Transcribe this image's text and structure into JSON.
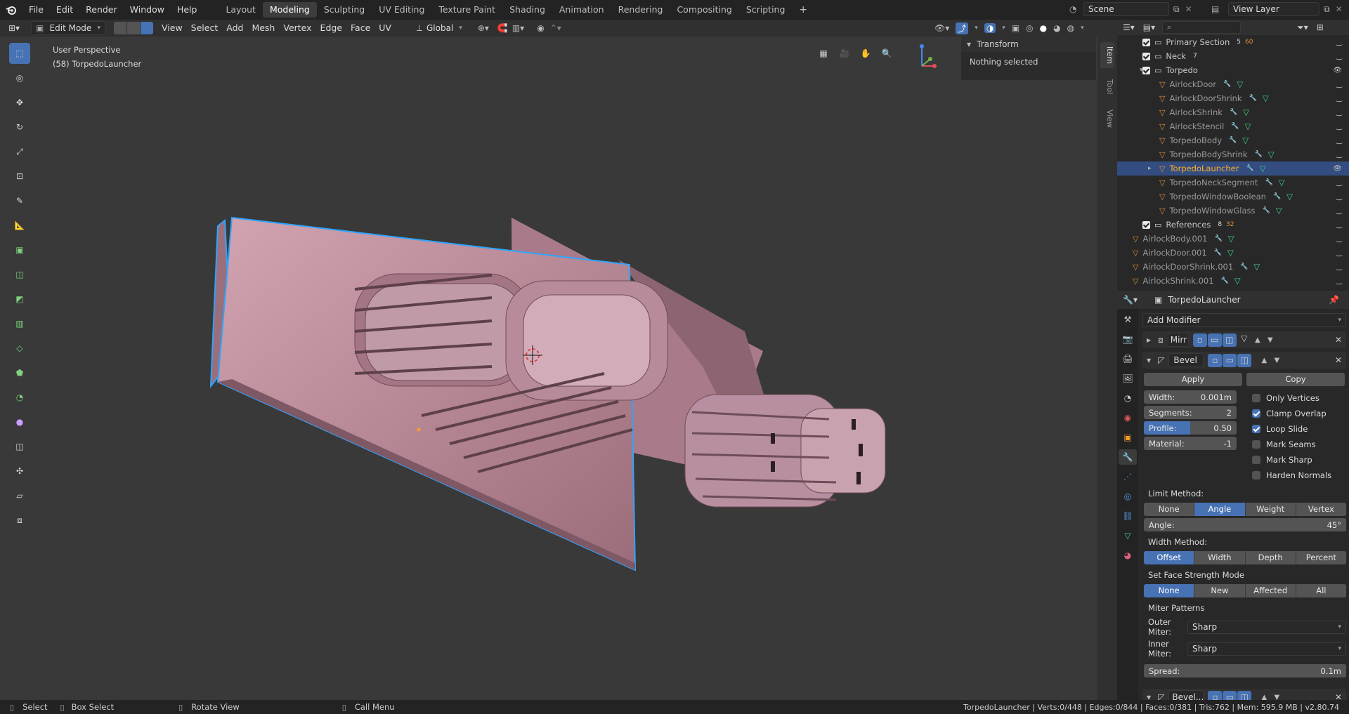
{
  "app": {
    "logo": "blender-logo-icon"
  },
  "topbar": {
    "menus": [
      "File",
      "Edit",
      "Render",
      "Window",
      "Help"
    ],
    "workspaces": [
      "Layout",
      "Modeling",
      "Sculpting",
      "UV Editing",
      "Texture Paint",
      "Shading",
      "Animation",
      "Rendering",
      "Compositing",
      "Scripting"
    ],
    "active_workspace": "Modeling",
    "add_workspace": "+",
    "scene": "Scene",
    "view_layer": "View Layer"
  },
  "viewport_header": {
    "mode": "Edit Mode",
    "menus": [
      "View",
      "Select",
      "Add",
      "Mesh",
      "Vertex",
      "Edge",
      "Face",
      "UV"
    ],
    "orientation": "Global"
  },
  "viewport": {
    "perspective": "User Perspective",
    "object": "(58) TorpedoLauncher",
    "side_tabs": [
      "Item",
      "Tool",
      "View"
    ],
    "transform_title": "Transform",
    "transform_msg": "Nothing selected",
    "colors": {
      "mesh": "#c58f9d",
      "selection": "#2ea5ff",
      "bg": "#393939"
    }
  },
  "outliner": {
    "search_placeholder": "",
    "rows": [
      {
        "name": "Primary Section",
        "indent": 1,
        "kind": "collection",
        "count": "5",
        "extra": "60"
      },
      {
        "name": "Neck",
        "indent": 1,
        "kind": "collection",
        "count": "7"
      },
      {
        "name": "Torpedo",
        "indent": 1,
        "kind": "collection"
      },
      {
        "name": "AirlockDoor",
        "indent": 2,
        "kind": "mesh"
      },
      {
        "name": "AirlockDoorShrink",
        "indent": 2,
        "kind": "mesh"
      },
      {
        "name": "AirlockShrink",
        "indent": 2,
        "kind": "mesh"
      },
      {
        "name": "AirlockStencil",
        "indent": 2,
        "kind": "mesh"
      },
      {
        "name": "TorpedoBody",
        "indent": 2,
        "kind": "mesh"
      },
      {
        "name": "TorpedoBodyShrink",
        "indent": 2,
        "kind": "mesh"
      },
      {
        "name": "TorpedoLauncher",
        "indent": 2,
        "kind": "mesh",
        "selected": true
      },
      {
        "name": "TorpedoNeckSegment",
        "indent": 2,
        "kind": "mesh"
      },
      {
        "name": "TorpedoWindowBoolean",
        "indent": 2,
        "kind": "mesh"
      },
      {
        "name": "TorpedoWindowGlass",
        "indent": 2,
        "kind": "mesh"
      },
      {
        "name": "References",
        "indent": 1,
        "kind": "collection",
        "count": "8",
        "extra": "32"
      },
      {
        "name": "AirlockBody.001",
        "indent": 0,
        "kind": "mesh"
      },
      {
        "name": "AirlockDoor.001",
        "indent": 0,
        "kind": "mesh"
      },
      {
        "name": "AirlockDoorShrink.001",
        "indent": 0,
        "kind": "mesh"
      },
      {
        "name": "AirlockShrink.001",
        "indent": 0,
        "kind": "mesh"
      }
    ]
  },
  "properties": {
    "object_name": "TorpedoLauncher",
    "add_modifier": "Add Modifier",
    "mirror_name": "Mirr",
    "bevel_name": "Bevel",
    "apply": "Apply",
    "copy": "Copy",
    "width_label": "Width:",
    "width_value": "0.001m",
    "segments_label": "Segments:",
    "segments_value": "2",
    "profile_label": "Profile:",
    "profile_value": "0.50",
    "profile_fill": 0.5,
    "material_label": "Material:",
    "material_value": "-1",
    "checks": [
      {
        "label": "Only Vertices",
        "on": false
      },
      {
        "label": "Clamp Overlap",
        "on": true
      },
      {
        "label": "Loop Slide",
        "on": true
      },
      {
        "label": "Mark Seams",
        "on": false
      },
      {
        "label": "Mark Sharp",
        "on": false
      },
      {
        "label": "Harden Normals",
        "on": false
      }
    ],
    "limit_method_label": "Limit Method:",
    "limit_methods": [
      "None",
      "Angle",
      "Weight",
      "Vertex Group"
    ],
    "limit_active": "Angle",
    "angle_label": "Angle:",
    "angle_value": "45°",
    "width_method_label": "Width Method:",
    "width_methods": [
      "Offset",
      "Width",
      "Depth",
      "Percent"
    ],
    "width_active": "Offset",
    "face_strength_label": "Set Face Strength Mode",
    "face_strength": [
      "None",
      "New",
      "Affected",
      "All"
    ],
    "face_active": "None",
    "miter_label": "Miter Patterns",
    "outer_miter_label": "Outer Miter:",
    "outer_miter": "Sharp",
    "inner_miter_label": "Inner Miter:",
    "inner_miter": "Sharp",
    "spread_label": "Spread:",
    "spread_value": "0.1m",
    "bevel2_name": "Bevel..."
  },
  "statusbar": {
    "select": "Select",
    "box_select": "Box Select",
    "rotate": "Rotate View",
    "call_menu": "Call Menu",
    "stats": "TorpedoLauncher | Verts:0/448 | Edges:0/844 | Faces:0/381 | Tris:762 | Mem: 595.9 MB | v2.80.74"
  }
}
